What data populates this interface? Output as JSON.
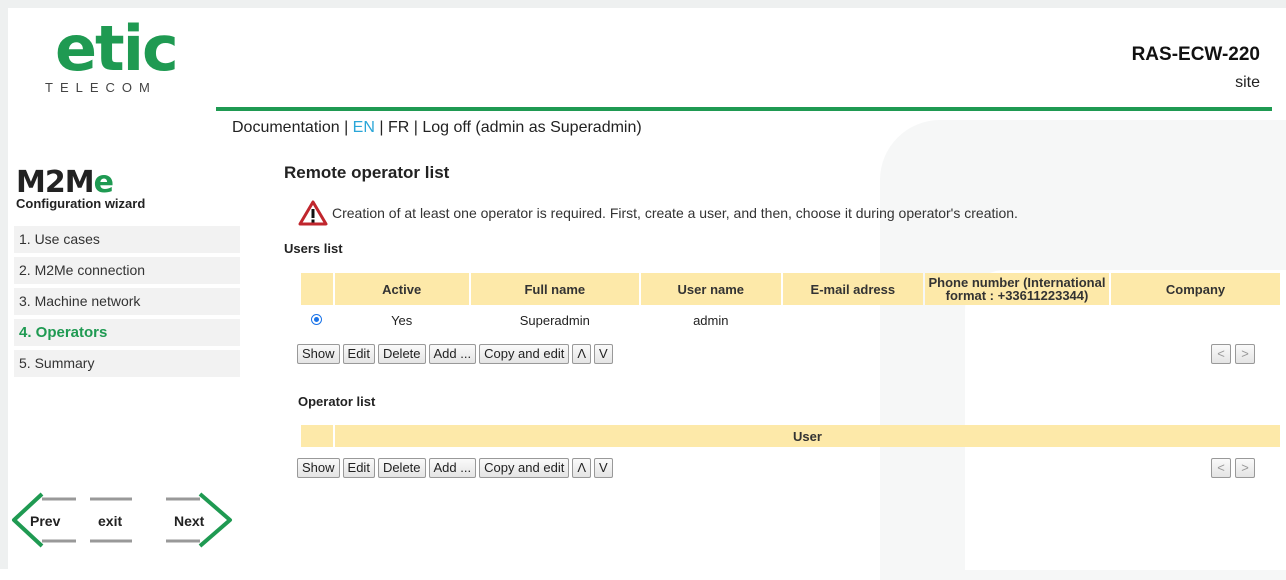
{
  "brand": {
    "logo_text": "etic",
    "logo_sub": "TELECOM",
    "model": "RAS-ECW-220",
    "site": "site"
  },
  "topnav": {
    "documentation": "Documentation",
    "sep1": " | ",
    "en": "EN",
    "sep2": " | ",
    "fr": "FR",
    "sep3": " | ",
    "logoff": "Log off (admin as Superadmin)"
  },
  "wizard": {
    "logo_main": "M2M",
    "logo_e": "e",
    "subtitle": "Configuration wizard",
    "steps": [
      {
        "label": "1. Use cases"
      },
      {
        "label": "2. M2Me connection"
      },
      {
        "label": "3. Machine network"
      },
      {
        "label": "4. Operators"
      },
      {
        "label": "5. Summary"
      }
    ],
    "current_step": 3,
    "prev_label": "Prev",
    "exit_label": "exit",
    "next_label": "Next"
  },
  "main": {
    "title": "Remote operator list",
    "warning": "Creation of at least one operator is required. First, create a user, and then, choose it during operator's creation.",
    "users": {
      "title": "Users list",
      "columns": [
        "Active",
        "Full name",
        "User name",
        "E-mail adress",
        "Phone number (International format : +33611223344)",
        "Company"
      ],
      "rows": [
        {
          "active": "Yes",
          "full_name": "Superadmin",
          "user_name": "admin",
          "email": "",
          "phone": "",
          "company": ""
        }
      ]
    },
    "operators": {
      "title": "Operator list",
      "columns": [
        "User"
      ]
    },
    "buttons": {
      "show": "Show",
      "edit": "Edit",
      "delete": "Delete",
      "add": "Add ...",
      "copy_edit": "Copy and edit",
      "up": "Λ",
      "down": "V",
      "prev_page": "<",
      "next_page": ">"
    }
  },
  "colors": {
    "brand_green": "#1f9a52",
    "header_fill": "#fde9a9",
    "active_lang": "#2aa6d8"
  }
}
